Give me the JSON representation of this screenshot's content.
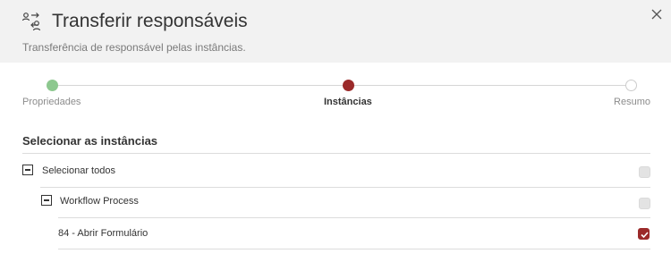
{
  "dialog": {
    "title": "Transferir responsáveis",
    "subtitle": "Transferência de responsável pelas instâncias.",
    "icon": "transfer-users-icon",
    "close_icon": "close-icon"
  },
  "stepper": {
    "steps": [
      {
        "label": "Propriedades",
        "state": "done"
      },
      {
        "label": "Instâncias",
        "state": "active"
      },
      {
        "label": "Resumo",
        "state": "pending"
      }
    ],
    "colors": {
      "done": "#8dc88f",
      "active": "#9b2a2a",
      "pending": "#ffffff"
    }
  },
  "instances": {
    "section_title": "Selecionar as instâncias",
    "select_all": {
      "label": "Selecionar todos",
      "checked": false,
      "disabled": true
    },
    "groups": [
      {
        "label": "Workflow Process",
        "checked": false,
        "disabled": true,
        "items": [
          {
            "label": "84 - Abrir Formulário",
            "checked": true
          }
        ]
      }
    ]
  },
  "colors": {
    "accent": "#9b2a2a",
    "header_bg": "#f2f2f2"
  }
}
